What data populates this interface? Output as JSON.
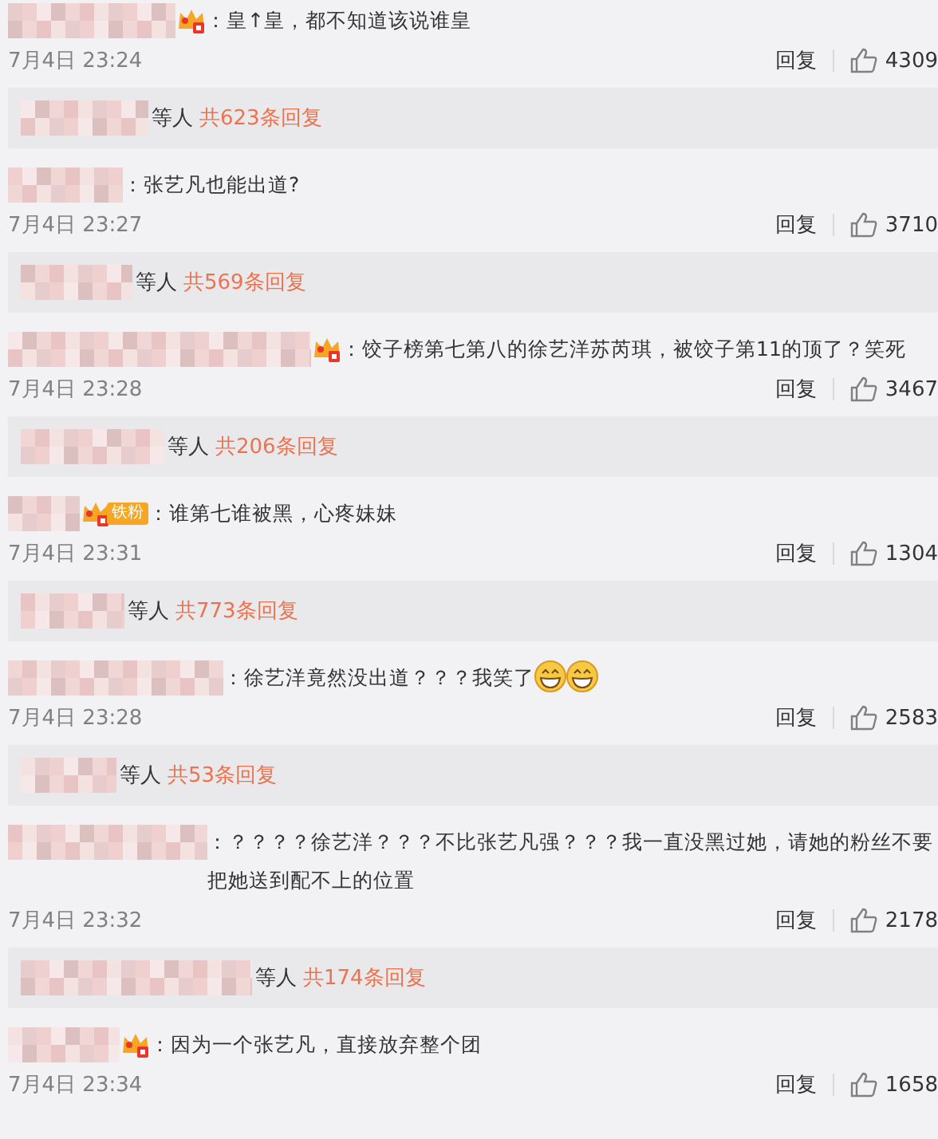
{
  "comments": [
    {
      "badge": {
        "kind": "crown"
      },
      "text": "：皇↑皇，都不知道该说谁皇",
      "time": "7月4日 23:24",
      "reply_action": "回复",
      "likes": "4309",
      "replies": {
        "suffix": "等人",
        "count": "共623条回复"
      }
    },
    {
      "text": "：张艺凡也能出道?",
      "time": "7月4日 23:27",
      "reply_action": "回复",
      "likes": "3710",
      "replies": {
        "suffix": "等人",
        "count": "共569条回复"
      }
    },
    {
      "badge": {
        "kind": "crown"
      },
      "text": "：饺子榜第七第八的徐艺洋苏芮琪，被饺子第11的顶了？笑死",
      "time": "7月4日 23:28",
      "reply_action": "回复",
      "likes": "3467",
      "replies": {
        "suffix": "等人",
        "count": "共206条回复"
      }
    },
    {
      "badge": {
        "kind": "fan",
        "label": "铁粉"
      },
      "text": "：谁第七谁被黑，心疼妹妹",
      "time": "7月4日 23:31",
      "reply_action": "回复",
      "likes": "1304",
      "replies": {
        "suffix": "等人",
        "count": "共773条回复"
      }
    },
    {
      "text": "：徐艺洋竟然没出道？？？我笑了",
      "emojis": [
        {
          "kind": "grin"
        },
        {
          "kind": "grin"
        }
      ],
      "time": "7月4日 23:28",
      "reply_action": "回复",
      "likes": "2583",
      "replies": {
        "suffix": "等人",
        "count": "共53条回复"
      }
    },
    {
      "text": "：？？？？徐艺洋？？？不比张艺凡强？？？我一直没黑过她，请她的粉丝不要把她送到配不上的位置",
      "time": "7月4日 23:32",
      "reply_action": "回复",
      "likes": "2178",
      "replies": {
        "suffix": "等人",
        "count": "共174条回复"
      }
    },
    {
      "badge": {
        "kind": "crown"
      },
      "text": "：因为一个张艺凡，直接放弃整个团",
      "time": "7月4日 23:34",
      "reply_action": "回复",
      "likes": "1658"
    }
  ]
}
